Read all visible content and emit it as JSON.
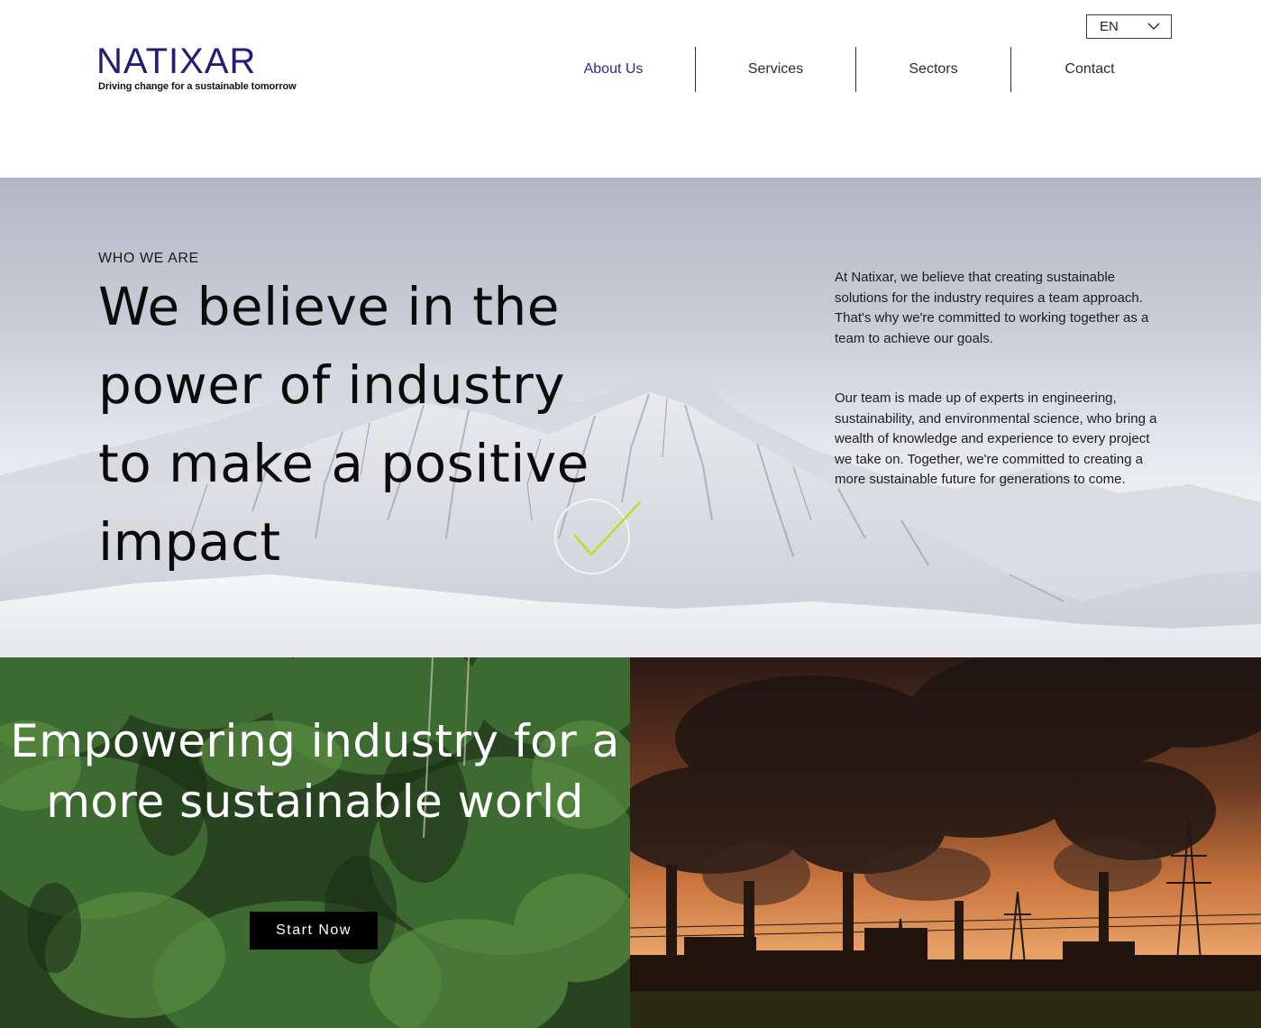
{
  "brand": {
    "name": "NATIXAR",
    "tagline": "Driving change for a sustainable tomorrow",
    "color": "#1f1f7a"
  },
  "language": {
    "selected": "EN",
    "icon": "chevron-down-icon"
  },
  "nav": {
    "items": [
      {
        "label": "About Us",
        "active": true
      },
      {
        "label": "Services",
        "active": false
      },
      {
        "label": "Sectors",
        "active": false
      },
      {
        "label": "Contact",
        "active": false
      }
    ],
    "active_color": "#2a2a8c"
  },
  "hero": {
    "eyebrow": "WHO WE ARE",
    "headline": "We believe in the power of industry to make a positive impact",
    "paragraph_1": "At Natixar, we believe that creating sustainable solutions for the industry requires a team approach. That's why we're committed to working together as a team to achieve our goals.",
    "paragraph_2": "Our team is made up of experts in engineering, sustainability, and environmental science, who bring a wealth of knowledge and experience to every project we take on. Together, we're committed to creating a more sustainable future for generations to come.",
    "background": "snowy-mountain-image",
    "check_icon": "check-circle-icon",
    "check_color": "#b8e02a"
  },
  "panels": {
    "forest": {
      "title": "Empowering industry for a more sustainable world",
      "cta_label": "Start Now",
      "background": "forest-image"
    },
    "factory": {
      "background": "smoking-factory-sunset-image"
    }
  }
}
